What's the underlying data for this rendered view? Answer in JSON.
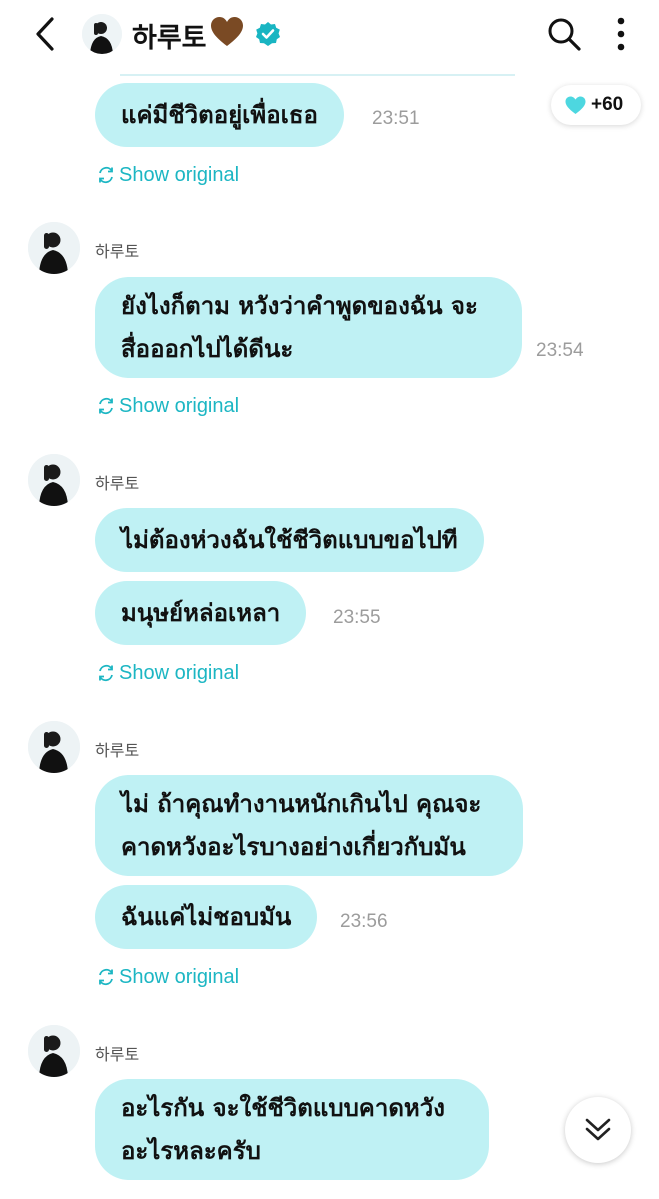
{
  "header": {
    "contact_name": "하루토",
    "heart_emoji": "🤎",
    "accent_color": "#1cb6c3"
  },
  "reaction": {
    "count": "+60",
    "color": "#4dd7e0"
  },
  "bubble_color": "#bff1f4",
  "show_original_label": "Show original",
  "groups": [
    {
      "sender": "",
      "messages": [
        "แค่มีชีวิตอยู่เพื่อเธอ"
      ],
      "time": "23:51"
    },
    {
      "sender": "하루토",
      "messages": [
        "ยังไงก็ตาม หวังว่าคำพูดของฉัน จะ",
        "สื่อออกไปได้ดีนะ"
      ],
      "time": "23:54"
    },
    {
      "sender": "하루토",
      "messages": [
        "ไม่ต้องห่วงฉันใช้ชีวิตแบบขอไปที",
        "มนุษย์หล่อเหลา"
      ],
      "time": "23:55"
    },
    {
      "sender": "하루토",
      "messages": [
        "ไม่ ถ้าคุณทำงานหนักเกินไป คุณจะ",
        "คาดหวังอะไรบางอย่างเกี่ยวกับมัน",
        "ฉันแค่ไม่ชอบมัน"
      ],
      "time": "23:56"
    },
    {
      "sender": "하루토",
      "messages": [
        "อะไรกัน จะใช้ชีวิตแบบคาดหวัง",
        "อะไรหละครับ"
      ],
      "time": ""
    }
  ]
}
